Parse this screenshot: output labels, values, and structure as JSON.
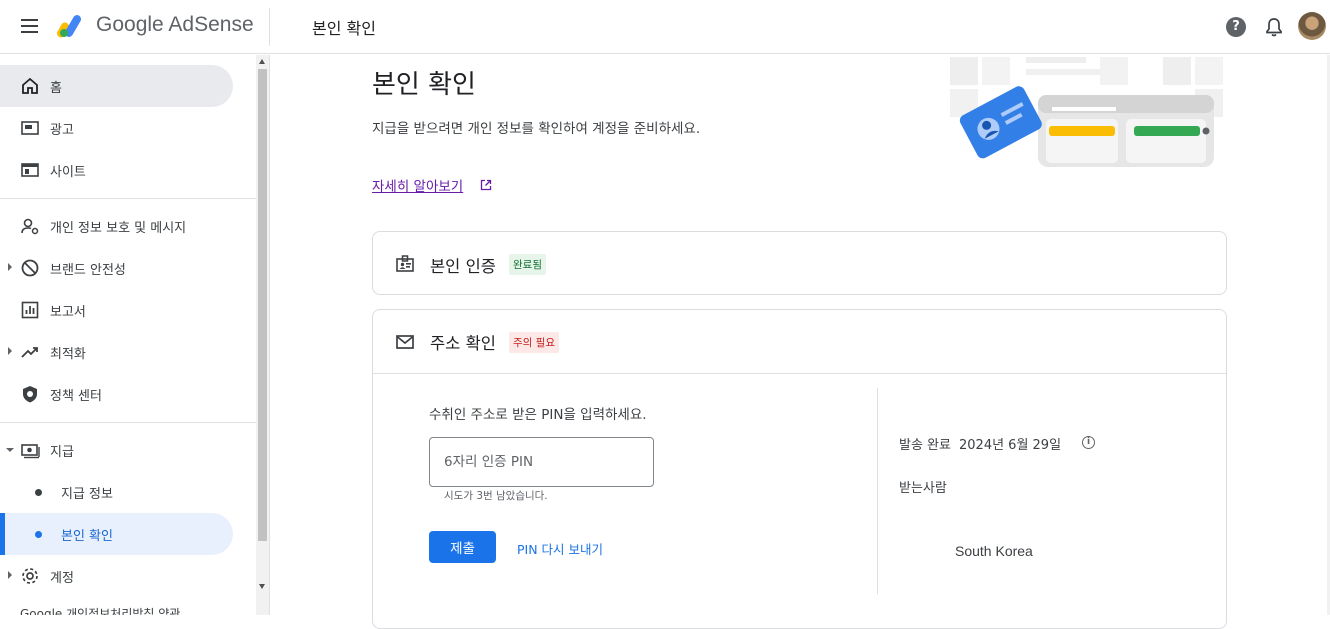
{
  "header": {
    "brand": "Google AdSense",
    "page_title": "본인 확인",
    "help_glyph": "?"
  },
  "sidebar": {
    "items": [
      {
        "label": "홈",
        "icon": "home-icon"
      },
      {
        "label": "광고",
        "icon": "ads-icon"
      },
      {
        "label": "사이트",
        "icon": "sites-icon"
      },
      {
        "label": "개인 정보 보호 및 메시지",
        "icon": "privacy-icon"
      },
      {
        "label": "브랜드 안전성",
        "icon": "block-icon"
      },
      {
        "label": "보고서",
        "icon": "reports-icon"
      },
      {
        "label": "최적화",
        "icon": "trending-icon"
      },
      {
        "label": "정책 센터",
        "icon": "policy-shield-icon"
      },
      {
        "label": "지급",
        "icon": "payments-icon"
      },
      {
        "label": "지급 정보",
        "icon": "dot-icon"
      },
      {
        "label": "본인 확인",
        "icon": "dot-icon"
      },
      {
        "label": "계정",
        "icon": "gear-icon"
      }
    ],
    "footer": "Google  개인정보처리방침  약관"
  },
  "main": {
    "title": "본인 확인",
    "description": "지급을 받으려면 개인 정보를 확인하여 계정을 준비하세요.",
    "learn_more": "자세히 알아보기"
  },
  "identity_card": {
    "title": "본인 인증",
    "status": "완료됨"
  },
  "address_card": {
    "title": "주소 확인",
    "status": "주의 필요",
    "prompt": "수취인 주소로 받은 PIN을 입력하세요.",
    "pin_placeholder": "6자리 인증 PIN",
    "attempts": "시도가 3번 남았습니다.",
    "submit": "제출",
    "resend": "PIN 다시 보내기",
    "sent_label": "발송 완료",
    "sent_date": "2024년 6월 29일",
    "recipient_label": "받는사람",
    "country": "South Korea"
  },
  "colors": {
    "accent": "#1a73e8",
    "success_bg": "#e6f4ea",
    "success_text": "#137333",
    "warn_bg": "#fce8e6",
    "warn_text": "#c5221f"
  }
}
